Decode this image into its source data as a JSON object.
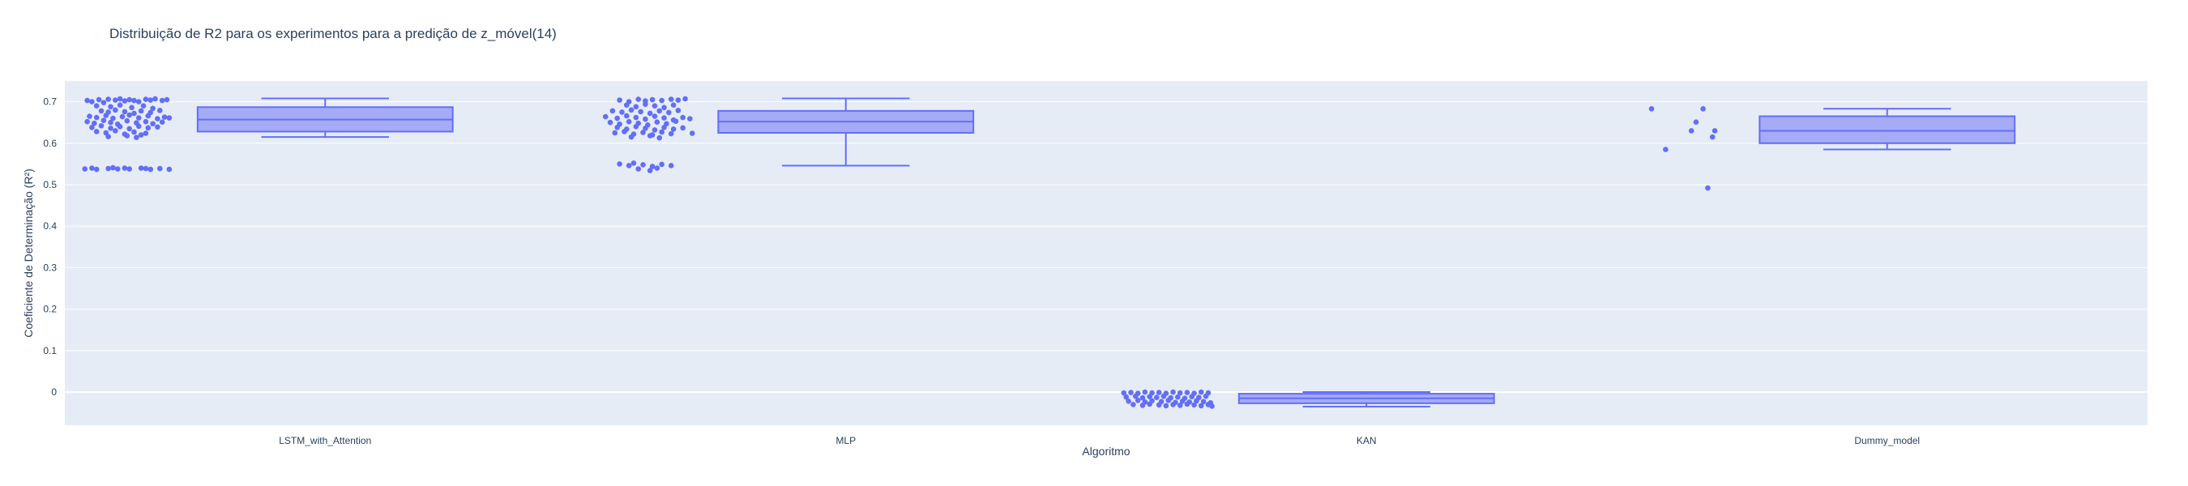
{
  "chart_data": {
    "type": "box",
    "title": "Distribuição de R2 para os experimentos para a predição de z_móvel(14)",
    "xlabel": "Algoritmo",
    "ylabel": "Coeficiente de Determinação (R²)",
    "ylim": [
      -0.08,
      0.75
    ],
    "yticks": [
      0,
      0.1,
      0.2,
      0.3,
      0.4,
      0.5,
      0.6,
      0.7
    ],
    "ytick_labels": [
      "0",
      "0.1",
      "0.2",
      "0.3",
      "0.4",
      "0.5",
      "0.6",
      "0.7"
    ],
    "grid": true,
    "colors": {
      "box_fill": "#a5abf5",
      "box_line": "#636efa",
      "point": "#636efa",
      "plot_bg": "#e5ecf6",
      "grid": "#ffffff",
      "text": "#2a3f5f"
    },
    "categories": [
      "LSTM_with_Attention",
      "MLP",
      "KAN",
      "Dummy_model"
    ],
    "boxes": [
      {
        "category": "LSTM_with_Attention",
        "lowerfence": 0.615,
        "q1": 0.628,
        "median": 0.657,
        "q3": 0.687,
        "upperfence": 0.708
      },
      {
        "category": "MLP",
        "lowerfence": 0.546,
        "q1": 0.625,
        "median": 0.652,
        "q3": 0.678,
        "upperfence": 0.708
      },
      {
        "category": "KAN",
        "lowerfence": -0.035,
        "q1": -0.027,
        "median": -0.015,
        "q3": -0.004,
        "upperfence": 0.0
      },
      {
        "category": "Dummy_model",
        "lowerfence": 0.585,
        "q1": 0.6,
        "median": 0.63,
        "q3": 0.665,
        "upperfence": 0.683
      }
    ],
    "points": [
      {
        "category": "LSTM_with_Attention",
        "jitter": [
          [
            -0.8,
            0.703
          ],
          [
            -0.7,
            0.7
          ],
          [
            -0.55,
            0.705
          ],
          [
            -0.45,
            0.698
          ],
          [
            -0.35,
            0.706
          ],
          [
            -0.2,
            0.704
          ],
          [
            -0.1,
            0.707
          ],
          [
            0.0,
            0.702
          ],
          [
            0.1,
            0.705
          ],
          [
            0.2,
            0.703
          ],
          [
            0.3,
            0.7
          ],
          [
            0.45,
            0.706
          ],
          [
            0.55,
            0.704
          ],
          [
            0.65,
            0.707
          ],
          [
            0.8,
            0.703
          ],
          [
            0.9,
            0.705
          ],
          [
            -0.6,
            0.69
          ],
          [
            -0.3,
            0.688
          ],
          [
            -0.1,
            0.692
          ],
          [
            0.15,
            0.686
          ],
          [
            0.4,
            0.69
          ],
          [
            0.6,
            0.684
          ],
          [
            -0.5,
            0.678
          ],
          [
            -0.35,
            0.675
          ],
          [
            -0.2,
            0.68
          ],
          [
            0.0,
            0.676
          ],
          [
            0.2,
            0.672
          ],
          [
            0.35,
            0.678
          ],
          [
            0.55,
            0.674
          ],
          [
            0.75,
            0.679
          ],
          [
            -0.75,
            0.665
          ],
          [
            -0.6,
            0.662
          ],
          [
            -0.4,
            0.667
          ],
          [
            -0.25,
            0.66
          ],
          [
            -0.05,
            0.664
          ],
          [
            0.1,
            0.668
          ],
          [
            0.3,
            0.661
          ],
          [
            0.5,
            0.666
          ],
          [
            0.7,
            0.659
          ],
          [
            0.85,
            0.663
          ],
          [
            0.95,
            0.661
          ],
          [
            -0.8,
            0.652
          ],
          [
            -0.65,
            0.648
          ],
          [
            -0.45,
            0.655
          ],
          [
            -0.3,
            0.65
          ],
          [
            -0.15,
            0.646
          ],
          [
            0.05,
            0.654
          ],
          [
            0.25,
            0.649
          ],
          [
            0.45,
            0.652
          ],
          [
            0.6,
            0.647
          ],
          [
            0.8,
            0.651
          ],
          [
            -0.7,
            0.638
          ],
          [
            -0.5,
            0.642
          ],
          [
            -0.3,
            0.636
          ],
          [
            -0.1,
            0.64
          ],
          [
            0.1,
            0.635
          ],
          [
            0.3,
            0.641
          ],
          [
            0.5,
            0.637
          ],
          [
            0.7,
            0.639
          ],
          [
            -0.6,
            0.628
          ],
          [
            -0.4,
            0.625
          ],
          [
            -0.2,
            0.63
          ],
          [
            0.0,
            0.622
          ],
          [
            0.2,
            0.627
          ],
          [
            0.35,
            0.62
          ],
          [
            0.45,
            0.624
          ],
          [
            -0.35,
            0.616
          ],
          [
            0.05,
            0.618
          ],
          [
            0.25,
            0.614
          ],
          [
            -0.85,
            0.538
          ],
          [
            -0.7,
            0.54
          ],
          [
            -0.6,
            0.537
          ],
          [
            -0.35,
            0.539
          ],
          [
            -0.25,
            0.541
          ],
          [
            -0.15,
            0.538
          ],
          [
            0.0,
            0.54
          ],
          [
            0.1,
            0.538
          ],
          [
            0.35,
            0.54
          ],
          [
            0.45,
            0.539
          ],
          [
            0.55,
            0.537
          ],
          [
            0.75,
            0.539
          ],
          [
            0.95,
            0.537
          ]
        ]
      },
      {
        "category": "MLP",
        "jitter": [
          [
            -0.55,
            0.704
          ],
          [
            -0.35,
            0.7
          ],
          [
            -0.15,
            0.706
          ],
          [
            0.0,
            0.702
          ],
          [
            0.15,
            0.705
          ],
          [
            0.35,
            0.703
          ],
          [
            0.55,
            0.706
          ],
          [
            0.7,
            0.704
          ],
          [
            0.85,
            0.707
          ],
          [
            -0.4,
            0.692
          ],
          [
            -0.2,
            0.688
          ],
          [
            0.0,
            0.694
          ],
          [
            0.2,
            0.69
          ],
          [
            0.4,
            0.686
          ],
          [
            0.6,
            0.692
          ],
          [
            -0.7,
            0.678
          ],
          [
            -0.5,
            0.675
          ],
          [
            -0.3,
            0.68
          ],
          [
            -0.1,
            0.676
          ],
          [
            0.1,
            0.672
          ],
          [
            0.3,
            0.678
          ],
          [
            0.5,
            0.674
          ],
          [
            0.7,
            0.679
          ],
          [
            -0.85,
            0.664
          ],
          [
            -0.6,
            0.66
          ],
          [
            -0.4,
            0.666
          ],
          [
            -0.2,
            0.662
          ],
          [
            0.0,
            0.658
          ],
          [
            0.2,
            0.665
          ],
          [
            0.4,
            0.661
          ],
          [
            0.6,
            0.656
          ],
          [
            0.8,
            0.662
          ],
          [
            0.95,
            0.659
          ],
          [
            -0.75,
            0.65
          ],
          [
            -0.55,
            0.646
          ],
          [
            -0.35,
            0.652
          ],
          [
            -0.15,
            0.648
          ],
          [
            0.05,
            0.644
          ],
          [
            0.25,
            0.651
          ],
          [
            0.45,
            0.647
          ],
          [
            0.65,
            0.653
          ],
          [
            -0.6,
            0.638
          ],
          [
            -0.4,
            0.634
          ],
          [
            -0.2,
            0.64
          ],
          [
            0.0,
            0.636
          ],
          [
            0.2,
            0.632
          ],
          [
            0.4,
            0.638
          ],
          [
            0.6,
            0.634
          ],
          [
            0.8,
            0.637
          ],
          [
            -0.65,
            0.625
          ],
          [
            -0.45,
            0.628
          ],
          [
            -0.25,
            0.622
          ],
          [
            -0.05,
            0.626
          ],
          [
            0.15,
            0.62
          ],
          [
            0.35,
            0.627
          ],
          [
            0.55,
            0.623
          ],
          [
            1.0,
            0.624
          ],
          [
            -0.3,
            0.615
          ],
          [
            0.1,
            0.618
          ],
          [
            0.3,
            0.613
          ],
          [
            -0.55,
            0.55
          ],
          [
            -0.35,
            0.546
          ],
          [
            -0.25,
            0.552
          ],
          [
            -0.05,
            0.548
          ],
          [
            0.15,
            0.544
          ],
          [
            0.35,
            0.549
          ],
          [
            0.55,
            0.546
          ],
          [
            -0.15,
            0.538
          ],
          [
            0.1,
            0.534
          ],
          [
            0.25,
            0.54
          ]
        ]
      },
      {
        "category": "KAN",
        "jitter": [
          [
            -0.9,
            -0.002
          ],
          [
            -0.75,
            -0.001
          ],
          [
            -0.6,
            -0.003
          ],
          [
            -0.45,
            0.0
          ],
          [
            -0.3,
            -0.002
          ],
          [
            -0.15,
            -0.001
          ],
          [
            0.0,
            -0.003
          ],
          [
            0.15,
            0.0
          ],
          [
            0.3,
            -0.002
          ],
          [
            0.45,
            -0.001
          ],
          [
            0.6,
            -0.003
          ],
          [
            0.75,
            0.0
          ],
          [
            0.9,
            -0.002
          ],
          [
            -0.85,
            -0.012
          ],
          [
            -0.65,
            -0.01
          ],
          [
            -0.5,
            -0.014
          ],
          [
            -0.35,
            -0.011
          ],
          [
            -0.2,
            -0.013
          ],
          [
            -0.05,
            -0.01
          ],
          [
            0.1,
            -0.014
          ],
          [
            0.25,
            -0.012
          ],
          [
            0.4,
            -0.015
          ],
          [
            0.55,
            -0.011
          ],
          [
            0.7,
            -0.013
          ],
          [
            0.85,
            -0.01
          ],
          [
            -0.8,
            -0.022
          ],
          [
            -0.6,
            -0.02
          ],
          [
            -0.45,
            -0.024
          ],
          [
            -0.3,
            -0.021
          ],
          [
            -0.1,
            -0.023
          ],
          [
            0.05,
            -0.02
          ],
          [
            0.2,
            -0.025
          ],
          [
            0.35,
            -0.022
          ],
          [
            0.5,
            -0.024
          ],
          [
            0.65,
            -0.021
          ],
          [
            0.8,
            -0.023
          ],
          [
            0.95,
            -0.026
          ],
          [
            -0.7,
            -0.03
          ],
          [
            -0.5,
            -0.032
          ],
          [
            -0.35,
            -0.029
          ],
          [
            -0.15,
            -0.031
          ],
          [
            0.0,
            -0.033
          ],
          [
            0.15,
            -0.03
          ],
          [
            0.3,
            -0.032
          ],
          [
            0.45,
            -0.029
          ],
          [
            0.6,
            -0.031
          ],
          [
            0.75,
            -0.033
          ],
          [
            0.9,
            -0.03
          ],
          [
            0.98,
            -0.034
          ]
        ]
      },
      {
        "category": "Dummy_model",
        "jitter": [
          [
            -0.75,
            0.683
          ],
          [
            0.35,
            0.683
          ],
          [
            0.2,
            0.651
          ],
          [
            -0.45,
            0.585
          ],
          [
            0.1,
            0.63
          ],
          [
            0.55,
            0.615
          ],
          [
            0.6,
            0.63
          ],
          [
            0.45,
            0.492
          ]
        ]
      }
    ]
  }
}
